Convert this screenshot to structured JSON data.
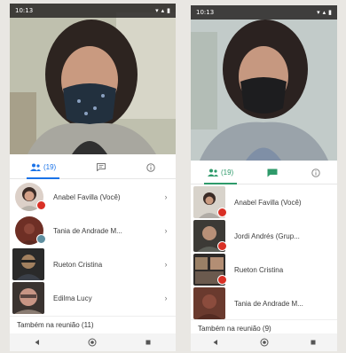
{
  "left": {
    "status_time": "10:13",
    "tabs": [
      {
        "label": "(19)",
        "icon": "people-icon"
      },
      {
        "label": "",
        "icon": "chat-icon"
      },
      {
        "label": "",
        "icon": "info-icon"
      }
    ],
    "participants": [
      {
        "name": "Anabel Favilla (Você)",
        "chevron": "›"
      },
      {
        "name": "Tania de Andrade M...",
        "chevron": "›"
      },
      {
        "name": "Rueton Cristina",
        "chevron": "›"
      },
      {
        "name": "Edilma Lucy",
        "chevron": "›"
      }
    ],
    "footer": "Também na reunião (11)"
  },
  "right": {
    "status_time": "10:13",
    "tabs": [
      {
        "label": "(19)",
        "icon": "people-icon"
      },
      {
        "label": "",
        "icon": "chat-icon"
      },
      {
        "label": "",
        "icon": "info-icon"
      }
    ],
    "participants": [
      {
        "name": "Anabel Favilla (Você)"
      },
      {
        "name": "Jordi Andrés (Grup..."
      },
      {
        "name": "Rueton Cristina"
      },
      {
        "name": "Tania de Andrade M..."
      }
    ],
    "footer": "Também na reunião (9)"
  },
  "colors": {
    "accent_blue": "#1a73e8",
    "accent_green": "#2e9a6a",
    "mic_off": "#d93025"
  }
}
